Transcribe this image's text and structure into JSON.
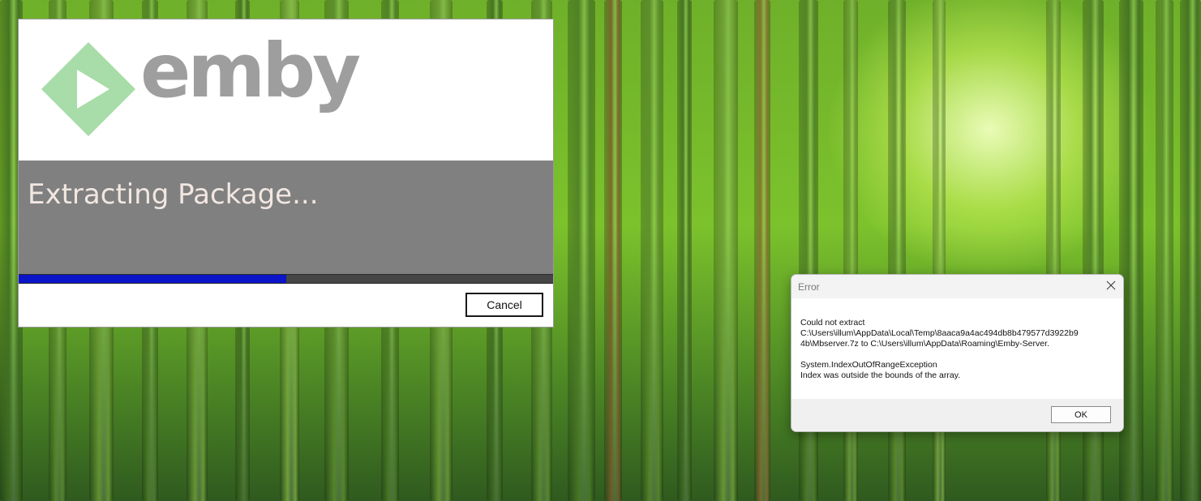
{
  "installer": {
    "logo_text": "emby",
    "status": "Extracting Package...",
    "progress_fraction": 0.5,
    "cancel_label": "Cancel",
    "colors": {
      "logo_mark": "#a8dca8",
      "logo_text": "#9e9e9e",
      "status_bg": "#808080",
      "progress_fill": "#0a14c8"
    }
  },
  "dialog": {
    "title": "Error",
    "lines": [
      "Could not extract",
      "C:\\Users\\illum\\AppData\\Local\\Temp\\8aaca9a4ac494db8b479577d3922b9",
      "4b\\Mbserver.7z to C:\\Users\\illum\\AppData\\Roaming\\Emby-Server.",
      "",
      "System.IndexOutOfRangeException",
      "Index was outside the bounds of the array."
    ],
    "ok_label": "OK"
  }
}
